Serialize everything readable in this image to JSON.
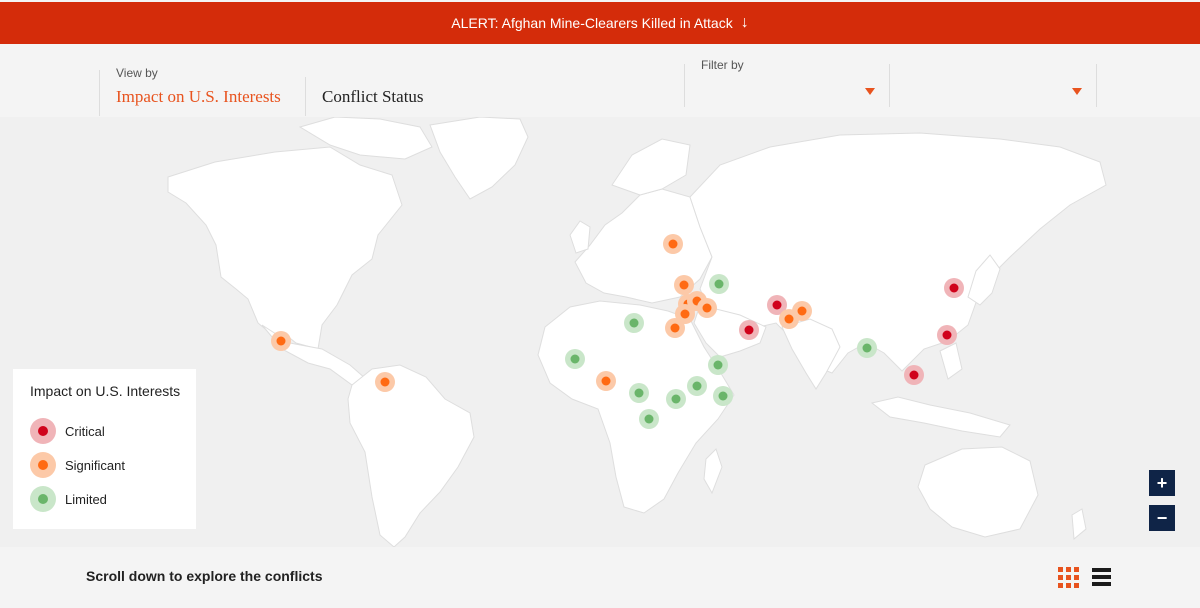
{
  "alert": {
    "text": "ALERT: Afghan Mine-Clearers Killed in Attack",
    "arrow": "↓"
  },
  "controls": {
    "view_by_label": "View by",
    "tabs": [
      {
        "label": "Impact on U.S. Interests",
        "active": true
      },
      {
        "label": "Conflict Status",
        "active": false
      }
    ],
    "filter_by_label": "Filter by",
    "filters": [
      {
        "selected": ""
      },
      {
        "selected": ""
      }
    ]
  },
  "legend": {
    "title": "Impact on U.S. Interests",
    "items": [
      {
        "label": "Critical",
        "color": "#d0021b",
        "halo": "#f0b4b8"
      },
      {
        "label": "Significant",
        "color": "#ff6a13",
        "halo": "#fcc9a8"
      },
      {
        "label": "Limited",
        "color": "#6ab56a",
        "halo": "#c9e6c9"
      }
    ]
  },
  "zoom": {
    "in": "+",
    "out": "−"
  },
  "footer": {
    "text": "Scroll down to explore the conflicts"
  },
  "colors": {
    "accent": "#e8531e",
    "alert_bg": "#d42c0a",
    "zoom_bg": "#0f2447"
  },
  "icons": [
    "down-arrow-icon",
    "caret-down-icon",
    "grid-view-icon",
    "list-view-icon"
  ]
}
